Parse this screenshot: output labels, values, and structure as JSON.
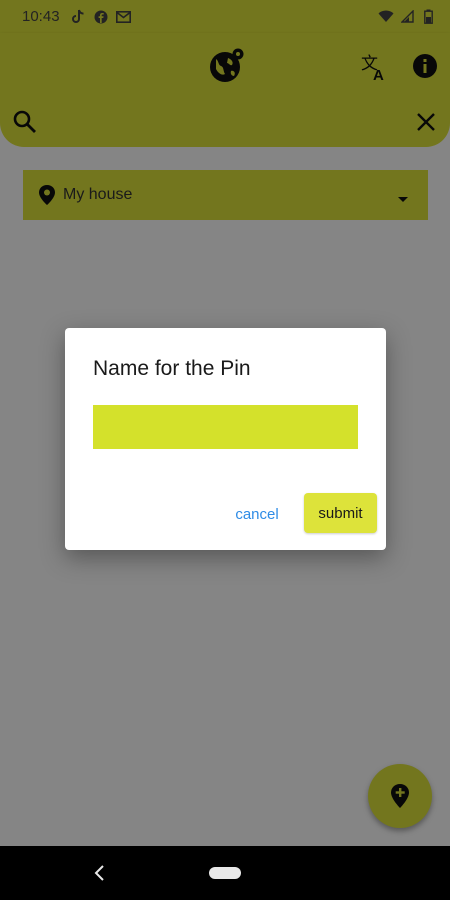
{
  "status_bar": {
    "time": "10:43",
    "notification_icons": [
      "tiktok-icon",
      "facebook-icon",
      "gmail-icon"
    ],
    "system_icons": [
      "wifi-icon",
      "signal-icon",
      "battery-icon"
    ]
  },
  "app_bar": {
    "icons": [
      "globe-pin-icon",
      "translate-icon",
      "info-icon"
    ]
  },
  "search": {
    "placeholder": "",
    "value": ""
  },
  "location_dropdown": {
    "selected": "My house"
  },
  "dialog": {
    "title": "Name for the Pin",
    "input_value": "",
    "cancel_label": "cancel",
    "submit_label": "submit"
  },
  "fab": {
    "icon": "add-location-icon"
  },
  "colors": {
    "accent": "#dde33a",
    "input_fill": "#d4e12b",
    "link_blue": "#2f8ce6",
    "scrim": "rgba(0,0,0,0.48)"
  }
}
